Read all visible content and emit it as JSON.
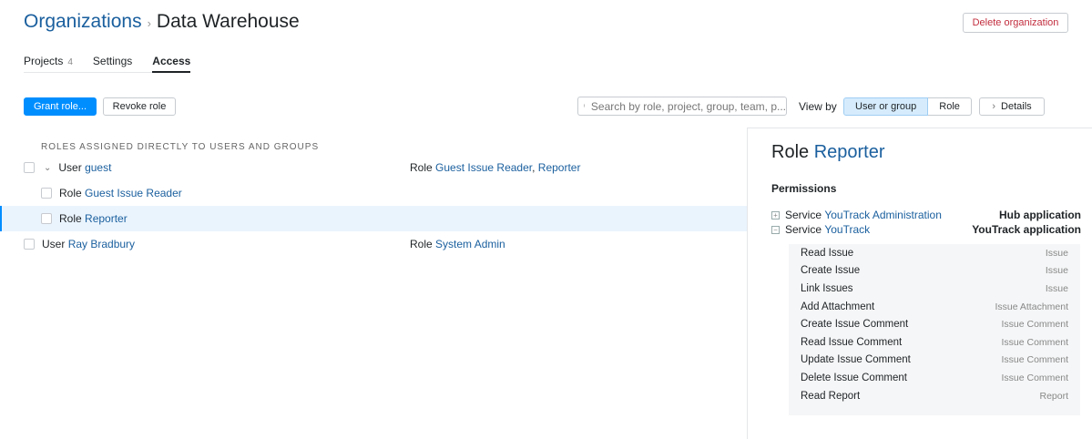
{
  "breadcrumb": {
    "parent": "Organizations",
    "separator": "›",
    "current": "Data Warehouse"
  },
  "delete_label": "Delete organization",
  "tabs": [
    {
      "label": "Projects",
      "count": "4"
    },
    {
      "label": "Settings"
    },
    {
      "label": "Access"
    }
  ],
  "toolbar": {
    "grant": "Grant role...",
    "revoke": "Revoke role",
    "search_placeholder": "Search by role, project, group, team, p...",
    "view_by": "View by",
    "view_user": "User or group",
    "view_role": "Role",
    "details": "Details"
  },
  "section_header": "ROLES ASSIGNED DIRECTLY TO USERS AND GROUPS",
  "rows": [
    {
      "prefix": "User",
      "name": "guest",
      "role_prefix": "Role",
      "roles": "Guest Issue Reader",
      "sep": ",",
      "roles2": "Reporter"
    },
    {
      "prefix": "Role",
      "name": "Guest Issue Reader"
    },
    {
      "prefix": "Role",
      "name": "Reporter"
    },
    {
      "prefix": "User",
      "name": "Ray Bradbury",
      "role_prefix": "Role",
      "roles": "System Admin"
    }
  ],
  "panel": {
    "title_prefix": "Role",
    "title_name": "Reporter",
    "permissions_label": "Permissions",
    "services": [
      {
        "prefix": "Service",
        "name": "YouTrack Administration",
        "app": "Hub application"
      },
      {
        "prefix": "Service",
        "name": "YouTrack",
        "app": "YouTrack application"
      }
    ],
    "items": [
      {
        "name": "Read Issue",
        "type": "Issue"
      },
      {
        "name": "Create Issue",
        "type": "Issue"
      },
      {
        "name": "Link Issues",
        "type": "Issue"
      },
      {
        "name": "Add Attachment",
        "type": "Issue Attachment"
      },
      {
        "name": "Create Issue Comment",
        "type": "Issue Comment"
      },
      {
        "name": "Read Issue Comment",
        "type": "Issue Comment"
      },
      {
        "name": "Update Issue Comment",
        "type": "Issue Comment"
      },
      {
        "name": "Delete Issue Comment",
        "type": "Issue Comment"
      },
      {
        "name": "Read Report",
        "type": "Report"
      }
    ]
  }
}
